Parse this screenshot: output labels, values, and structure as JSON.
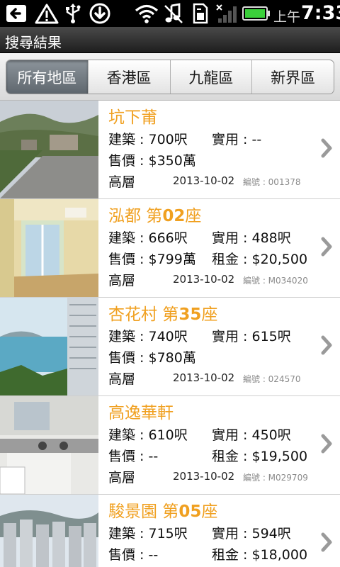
{
  "status_bar": {
    "time_ampm": "上午",
    "time": "7:33",
    "icons": [
      "back-arrow-icon",
      "warning-icon",
      "usb-icon",
      "download-icon",
      "wifi-icon",
      "music-off-icon",
      "sim-card-icon",
      "signal-icon",
      "battery-icon"
    ]
  },
  "header": {
    "title": "搜尋結果"
  },
  "tabs": [
    {
      "label": "所有地區",
      "active": true
    },
    {
      "label": "香港區",
      "active": false
    },
    {
      "label": "九龍區",
      "active": false
    },
    {
      "label": "新界區",
      "active": false
    }
  ],
  "listings": [
    {
      "name": "坑下莆",
      "block_prefix": "",
      "block_num": "",
      "block_suffix": "",
      "gross": "建築 : 700呎",
      "net": "實用 : --",
      "price": "售價 : $350萬",
      "rent": "",
      "floor": "高層",
      "date": "2013-10-02",
      "ref": "編號 : 001378"
    },
    {
      "name": "泓都",
      "block_prefix": " 第",
      "block_num": "02",
      "block_suffix": "座",
      "gross": "建築 : 666呎",
      "net": "實用 : 488呎",
      "price": "售價 : $799萬",
      "rent": "租金 : $20,500",
      "floor": "高層",
      "date": "2013-10-02",
      "ref": "編號 : M034020"
    },
    {
      "name": "杏花村",
      "block_prefix": " 第",
      "block_num": "35",
      "block_suffix": "座",
      "gross": "建築 : 740呎",
      "net": "實用 : 615呎",
      "price": "售價 : $780萬",
      "rent": "",
      "floor": "高層",
      "date": "2013-10-02",
      "ref": "編號 : 024570"
    },
    {
      "name": "高逸華軒",
      "block_prefix": "",
      "block_num": "",
      "block_suffix": "",
      "gross": "建築 : 610呎",
      "net": "實用 : 450呎",
      "price": "售價 : --",
      "rent": "租金 : $19,500",
      "floor": "高層",
      "date": "2013-10-02",
      "ref": "編號 : M029709"
    },
    {
      "name": "駿景園",
      "block_prefix": " 第",
      "block_num": "05",
      "block_suffix": "座",
      "gross": "建築 : 715呎",
      "net": "實用 : 594呎",
      "price": "售價 : --",
      "rent": "租金 : $18,000",
      "floor": "",
      "date": "",
      "ref": ""
    }
  ],
  "colors": {
    "name_accent": "#f0a020",
    "active_tab": "#6f777e",
    "ref_text": "#8a8a8a"
  }
}
